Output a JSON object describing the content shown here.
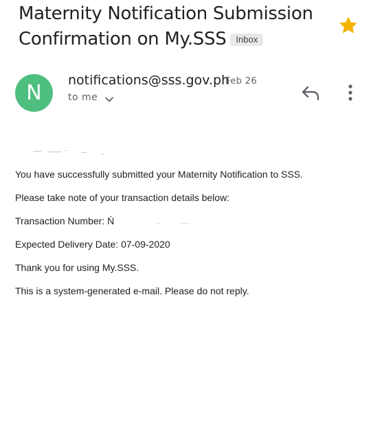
{
  "email": {
    "subject": "Maternity Notification Submission Confirmation on My.SSS",
    "label_chip": "Inbox",
    "sender_initial": "N",
    "sender": "notifications@sss.gov.ph",
    "date": "Feb 26",
    "recipient": "to me",
    "starred": true
  },
  "body_lines": [
    "You have successfully submitted your Maternity Notification to SSS.",
    "Please take note of your transaction details below:",
    "Transaction Number: Ń",
    "Expected Delivery Date: 07-09-2020",
    "Thank you for using My.SSS.",
    "This is a system-generated e-mail. Please do not reply."
  ],
  "icons": {
    "star": "star-icon",
    "reply": "reply-icon",
    "more": "more-vert-icon",
    "expand": "chevron-down-icon"
  },
  "colors": {
    "star": "#f4b400",
    "avatar": "#4fbf7f",
    "chip_bg": "#e8e8e8",
    "secondary_text": "#5f6368"
  }
}
